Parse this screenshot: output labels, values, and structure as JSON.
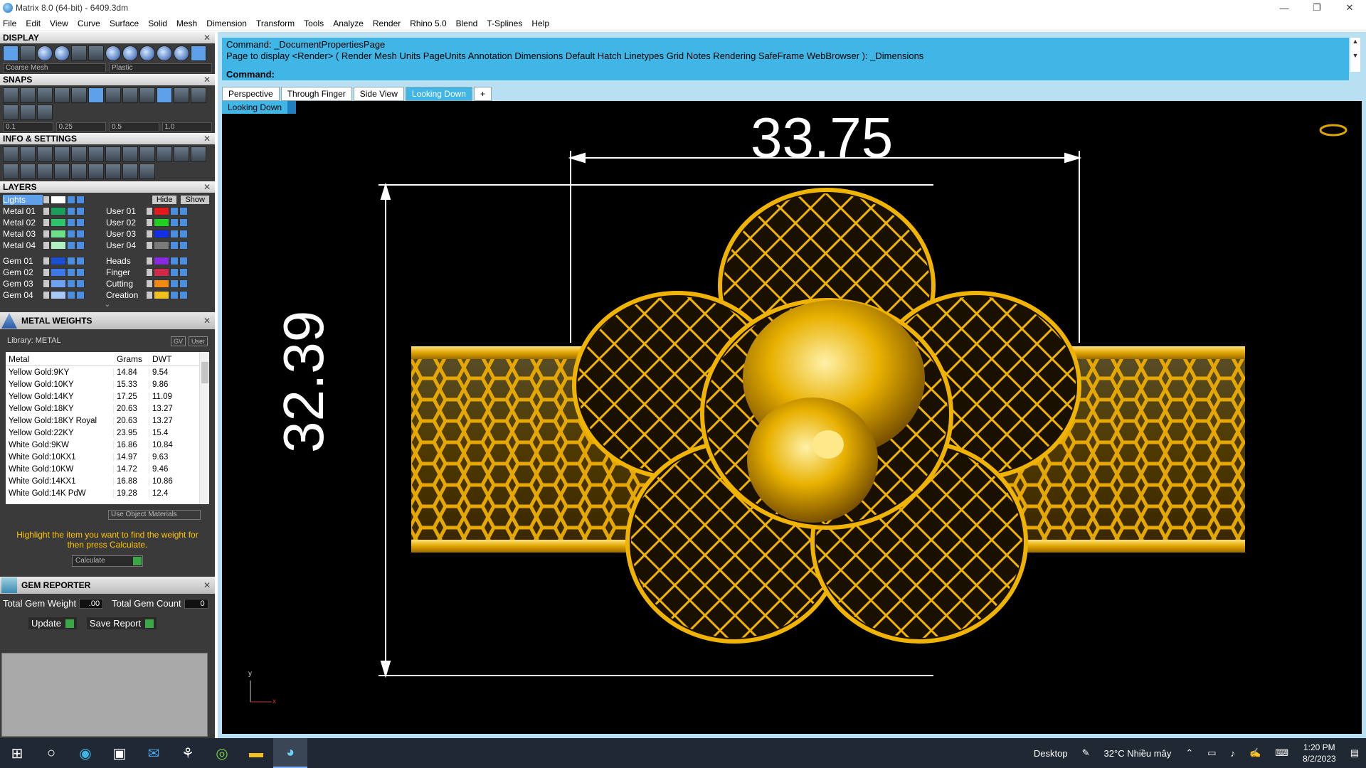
{
  "window": {
    "title": "Matrix 8.0 (64-bit) - 6409.3dm"
  },
  "menu": [
    "File",
    "Edit",
    "View",
    "Curve",
    "Surface",
    "Solid",
    "Mesh",
    "Dimension",
    "Transform",
    "Tools",
    "Analyze",
    "Render",
    "Rhino 5.0",
    "Blend",
    "T-Splines",
    "Help"
  ],
  "panels": {
    "display": "DISPLAY",
    "display_sel1": "Coarse Mesh",
    "display_sel2": "Plastic",
    "snaps": "SNAPS",
    "snap_values": [
      "0.1",
      "0.25",
      "0.5",
      "1.0"
    ],
    "info": "INFO & SETTINGS",
    "layers": "LAYERS"
  },
  "layers": {
    "lights": "Lights",
    "hide": "Hide",
    "show": "Show",
    "left": [
      {
        "name": "Metal 01",
        "color": "#1aa05a"
      },
      {
        "name": "Metal 02",
        "color": "#2ec46a"
      },
      {
        "name": "Metal 03",
        "color": "#6ee08a"
      },
      {
        "name": "Metal 04",
        "color": "#b2f0c2"
      },
      {
        "name": "Gem 01",
        "color": "#1a4fd0"
      },
      {
        "name": "Gem 02",
        "color": "#3c78e8"
      },
      {
        "name": "Gem 03",
        "color": "#6ea2f0"
      },
      {
        "name": "Gem 04",
        "color": "#a8c8f8"
      }
    ],
    "right": [
      {
        "name": "User 01",
        "color": "#e21a1a"
      },
      {
        "name": "User 02",
        "color": "#20d020"
      },
      {
        "name": "User 03",
        "color": "#1030e8"
      },
      {
        "name": "User 04",
        "color": "#7a7a7a"
      },
      {
        "name": "Heads",
        "color": "#8a2ae0"
      },
      {
        "name": "Finger",
        "color": "#d02a4a"
      },
      {
        "name": "Cutting",
        "color": "#f08a10"
      },
      {
        "name": "Creation",
        "color": "#f0c020"
      }
    ]
  },
  "metal_weights": {
    "title": "METAL WEIGHTS",
    "library": "Library: METAL",
    "gv": "GV",
    "user": "User",
    "headers": [
      "Metal",
      "Grams",
      "DWT"
    ],
    "rows": [
      [
        "Yellow Gold:9KY",
        "14.84",
        "9.54"
      ],
      [
        "Yellow Gold:10KY",
        "15.33",
        "9.86"
      ],
      [
        "Yellow Gold:14KY",
        "17.25",
        "11.09"
      ],
      [
        "Yellow Gold:18KY",
        "20.63",
        "13.27"
      ],
      [
        "Yellow Gold:18KY Royal",
        "20.63",
        "13.27"
      ],
      [
        "Yellow Gold:22KY",
        "23.95",
        "15.4"
      ],
      [
        "White Gold:9KW",
        "16.86",
        "10.84"
      ],
      [
        "White Gold:10KX1",
        "14.97",
        "9.63"
      ],
      [
        "White Gold:10KW",
        "14.72",
        "9.46"
      ],
      [
        "White Gold:14KX1",
        "16.88",
        "10.86"
      ],
      [
        "White Gold:14K PdW",
        "19.28",
        "12.4"
      ]
    ],
    "use_object": "Use Object Materials",
    "hint": "Highlight the item you want to find the weight for then press Calculate.",
    "calculate": "Calculate"
  },
  "gem_reporter": {
    "title": "GEM REPORTER",
    "weight_label": "Total Gem Weight",
    "weight_value": ".00",
    "count_label": "Total Gem Count",
    "count_value": "0",
    "update": "Update",
    "save": "Save Report"
  },
  "command": {
    "line1": "Command: _DocumentPropertiesPage",
    "line2": "Page to display <Render> ( Render  Mesh  Units  PageUnits  Annotation  Dimensions  Default  Hatch  Linetypes  Grid  Notes  Rendering  SafeFrame  WebBrowser ): _Dimensions",
    "prompt": "Command:"
  },
  "tabs": [
    "Perspective",
    "Through Finger",
    "Side View",
    "Looking Down"
  ],
  "active_tab": "Looking Down",
  "viewport_label": "Looking Down",
  "dims": {
    "width": "33.75",
    "height": "32.39"
  },
  "axis": {
    "y": "y",
    "x": "x"
  },
  "taskbar": {
    "desktop": "Desktop",
    "weather": "32°C  Nhiều mây",
    "time": "1:20 PM",
    "date": "8/2/2023"
  }
}
